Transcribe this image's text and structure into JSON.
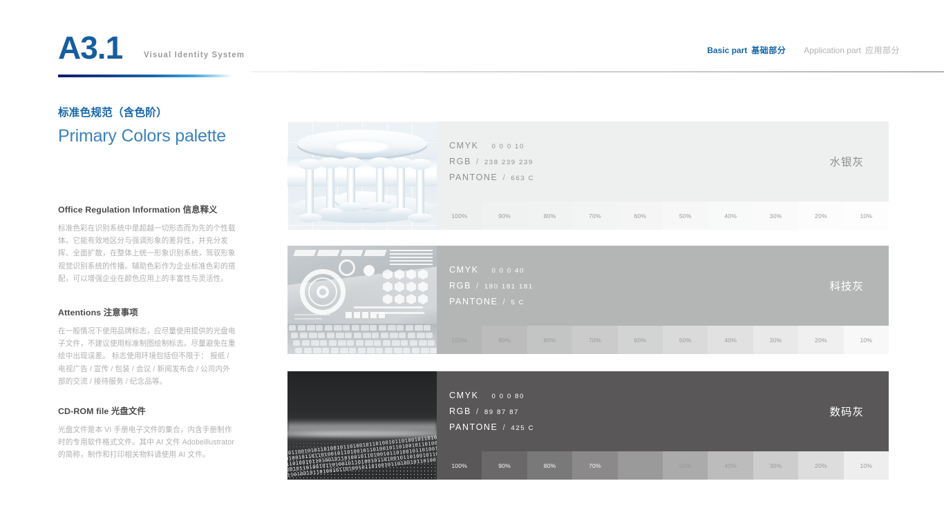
{
  "header": {
    "code": "A3.1",
    "subtitle": "Visual Identity System",
    "nav": [
      {
        "en": "Basic part",
        "cn": "基础部分",
        "active": true
      },
      {
        "en": "Application part",
        "cn": "应用部分",
        "active": false
      }
    ]
  },
  "section": {
    "title_cn": "标准色规范（含色阶）",
    "title_en": "Primary Colors palette"
  },
  "blocks": [
    {
      "heading": "Office Regulation Information 信息释义",
      "body": "标准色彩在识别系统中是超越一切形态而为先的个性载体。它能有效地区分与强调形象的差异性，并充分发挥、全面扩散，在整体上统一形象识别系统，驾驭形象视觉识别系统的传播。辅助色彩作为企业标准色彩的搭配，可以增强企业在颜色应用上的丰富性与灵活性。"
    },
    {
      "heading": "Attentions 注意事项",
      "body": "在一般情况下使用品牌标志，应尽量使用提供的光盘电子文件，不建议使用标准制图绘制标志。尽量避免在重绘中出现误差。\n标志使用环境包括但不限于：\n报纸 / 电视广告 / 宣传 / 包装 / 会议 / 新闻发布会 / 公司内外部的交流 / 接待服务 / 纪念品等。"
    },
    {
      "heading": "CD-ROM file 光盘文件",
      "body": "光盘文件是本 VI 手册电子文件的集合，内含手册制作时的专用软件格式文件。其中 AI 文件 Adobeillustrator 的简称，制作和打印相关物料请使用 AI 文件。"
    }
  ],
  "labels": {
    "cmyk": "CMYK",
    "rgb": "RGB",
    "pantone": "PANTONE",
    "slash": "/"
  },
  "tint_steps": [
    "100%",
    "90%",
    "80%",
    "70%",
    "60%",
    "50%",
    "40%",
    "30%",
    "20%",
    "10%"
  ],
  "palette": [
    {
      "name_cn": "水银灰",
      "image": "white-futuristic-room-photo",
      "cmyk": "0  0  0  10",
      "rgb": "238  239  239",
      "pantone": "663 C",
      "hex": "#eeefef",
      "text_color": "#8f8f8f",
      "name_color": "#8f8f8f"
    },
    {
      "name_cn": "科技灰",
      "image": "tech-hud-interface-photo",
      "cmyk": "0  0  0  40",
      "rgb": "180  181  181",
      "pantone": "5 C",
      "hex": "#b4b5b5",
      "text_color": "#ffffff",
      "name_color": "#ffffff"
    },
    {
      "name_cn": "数码灰",
      "image": "binary-code-landscape-photo",
      "cmyk": "0  0  0  80",
      "rgb": "89  87  87",
      "pantone": "425 C",
      "hex": "#595757",
      "text_color": "#ffffff",
      "name_color": "#ffffff"
    }
  ],
  "colors": {
    "accent_blue": "#1565a8",
    "title_blue": "#3b82bd",
    "body_gray": "#b0b0b0",
    "heading_gray": "#4a4a4a"
  }
}
